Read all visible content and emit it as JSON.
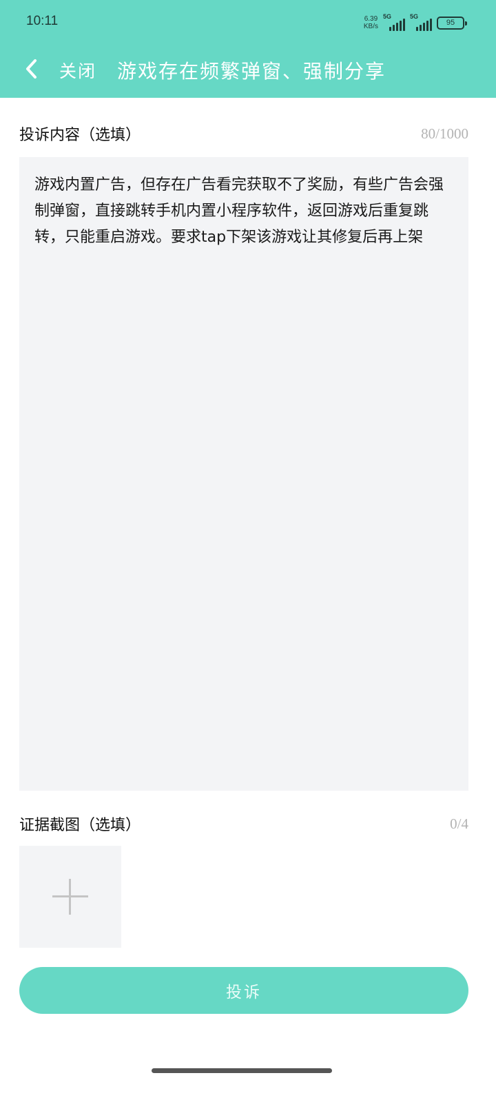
{
  "status_bar": {
    "time": "10:11",
    "net_speed_value": "6.39",
    "net_speed_unit": "KB/s",
    "sim1_label": "5G",
    "sim2_label": "5G",
    "battery": "95"
  },
  "header": {
    "close_label": "关闭",
    "title": "游戏存在频繁弹窗、强制分享",
    "back_icon": "chevron-left-icon"
  },
  "complaint": {
    "label": "投诉内容（选填）",
    "counter": "80/1000",
    "text": "游戏内置广告，但存在广告看完获取不了奖励，有些广告会强制弹窗，直接跳转手机内置小程序软件，返回游戏后重复跳转，只能重启游戏。要求tap下架该游戏让其修复后再上架"
  },
  "evidence": {
    "label": "证据截图（选填）",
    "counter": "0/4",
    "add_icon": "plus-icon"
  },
  "submit_label": "投诉",
  "colors": {
    "accent": "#66d8c5",
    "input_bg": "#f3f4f6",
    "muted_text": "#b3b3b3"
  }
}
